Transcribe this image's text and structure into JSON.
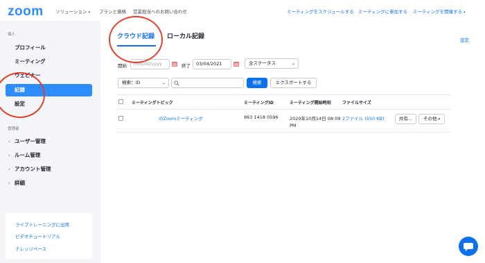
{
  "brand": {
    "logo": "zoom",
    "color": "#2D8CFF"
  },
  "topnav": {
    "left": [
      {
        "label": "ソリューション",
        "has_caret": true
      },
      {
        "label": "プランと価格"
      },
      {
        "label": "営業担当へのお問い合わせ"
      }
    ],
    "right": [
      {
        "label": "ミーティングをスケジュールする"
      },
      {
        "label": "ミーティングに参加する"
      },
      {
        "label": "ミーティングを開催する"
      }
    ]
  },
  "sidebar": {
    "personal_label": "個人",
    "personal_items": [
      {
        "label": "プロフィール"
      },
      {
        "label": "ミーティング"
      },
      {
        "label": "ウェビナー"
      },
      {
        "label": "記録",
        "active": true
      },
      {
        "label": "設定"
      }
    ],
    "admin_label": "管理者",
    "admin_items": [
      {
        "label": "ユーザー管理"
      },
      {
        "label": "ルーム管理"
      },
      {
        "label": "アカウント管理"
      },
      {
        "label": "詳細"
      }
    ],
    "bottom_links": [
      {
        "label": "ライブトレーニングに出席"
      },
      {
        "label": "ビデオチュートリアル"
      },
      {
        "label": "ナレッジベース"
      }
    ]
  },
  "tabs": [
    {
      "label": "クラウド記録",
      "active": true
    },
    {
      "label": "ローカル記録",
      "active": false
    }
  ],
  "settings_link": "設定",
  "filters": {
    "start_label": "開始",
    "start_placeholder": "mm/dd/yyyy",
    "end_label": "終了",
    "end_value": "03/04/2021",
    "status_select": "全ステータス",
    "search_select": "検索：ID",
    "search_button": "検索",
    "export_button": "エクスポートする"
  },
  "table": {
    "headers": [
      "ミーティングトピック",
      "ミーティングID",
      "ミーティング開始時刻",
      "ファイルサイズ"
    ],
    "rows": [
      {
        "topic": "のZoomミーティング",
        "meeting_id": "863 1418 0596",
        "start_time_line1": "2020年10月14日 08:09",
        "start_time_line2": "PM",
        "file_size": "2ファイル (550 KB)",
        "share_button": "共有...",
        "more_button": "その他"
      }
    ]
  },
  "colors": {
    "accent": "#0E71EB",
    "annotation": "#e0402c",
    "sidebar_bg": "#F4F5F8"
  }
}
